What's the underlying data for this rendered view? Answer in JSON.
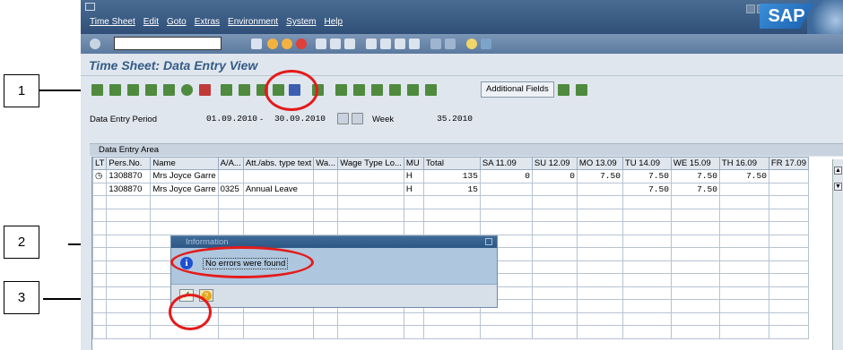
{
  "callouts": [
    "1",
    "2",
    "3"
  ],
  "menu": [
    "Time Sheet",
    "Edit",
    "Goto",
    "Extras",
    "Environment",
    "System",
    "Help"
  ],
  "brand": "SAP",
  "screen_title": "Time Sheet: Data Entry View",
  "toolbar": {
    "additional_fields": "Additional Fields"
  },
  "period": {
    "label": "Data Entry Period",
    "from": "01.09.2010",
    "separator": "-",
    "to": "30.09.2010",
    "week_label": "Week",
    "week_value": "35.2010"
  },
  "entry_area_label": "Data Entry Area",
  "columns": [
    "LT",
    "Pers.No.",
    "Name",
    "A/A...",
    "Att./abs. type text",
    "Wa...",
    "Wage Type Lo...",
    "MU",
    "Total",
    "SA 11.09",
    "SU 12.09",
    "MO 13.09",
    "TU 14.09",
    "WE 15.09",
    "TH 16.09",
    "FR 17.09"
  ],
  "rows": [
    {
      "lt": "clock",
      "pers": "1308870",
      "name": "Mrs Joyce Garre",
      "aa": "",
      "text": "",
      "wa": "",
      "wtl": "",
      "mu": "H",
      "total": "135",
      "sa": "0",
      "su": "0",
      "mo": "7.50",
      "tu": "7.50",
      "we": "7.50",
      "th": "7.50",
      "fr": ""
    },
    {
      "lt": "",
      "pers": "1308870",
      "name": "Mrs Joyce Garre",
      "aa": "0325",
      "text": "Annual Leave",
      "wa": "",
      "wtl": "",
      "mu": "H",
      "total": "15",
      "sa": "",
      "su": "",
      "mo": "",
      "tu": "7.50",
      "we": "7.50",
      "th": "",
      "fr": ""
    }
  ],
  "dialog": {
    "title": "Information",
    "message": "No errors were found"
  },
  "colors": {
    "sap_blue": "#2f4f78",
    "circle_red": "#e41b1b",
    "dialog_bg": "#aec7df",
    "title_text": "#355c86"
  }
}
